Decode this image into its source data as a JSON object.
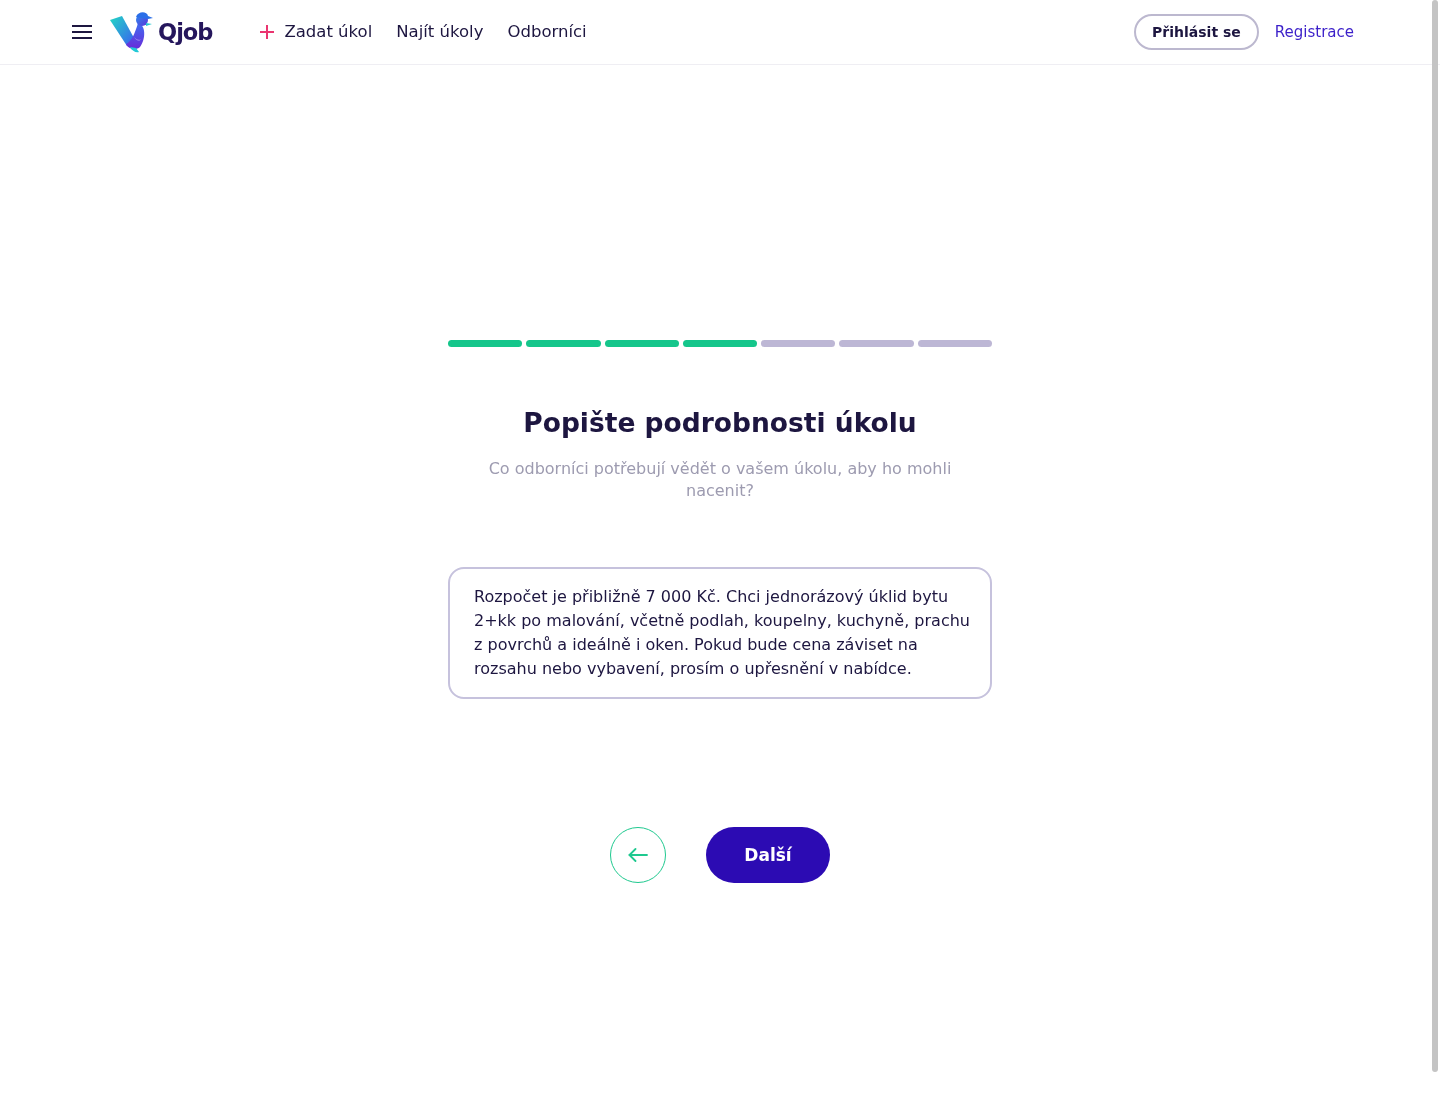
{
  "header": {
    "logo": "Qjob",
    "nav": [
      {
        "label": "Zadat úkol",
        "kind": "add"
      },
      {
        "label": "Najít úkoly",
        "kind": "link"
      },
      {
        "label": "Odborníci",
        "kind": "link"
      }
    ],
    "login_button": "Přihlásit se",
    "register_link": "Registrace"
  },
  "progress": {
    "steps": [
      {
        "completed": true
      },
      {
        "completed": true
      },
      {
        "completed": true
      },
      {
        "completed": true
      },
      {
        "completed": false
      },
      {
        "completed": false
      },
      {
        "completed": false
      }
    ]
  },
  "title": "Popište podrobnosti úkolu",
  "subtitle": "Co odborníci potřebují vědět o vašem úkolu, aby ho mohli nacenit?",
  "description": {
    "value": "Rozpočet je přibližně 7 000 Kč. Chci jednorázový úklid bytu 2+kk po malování, včetně podlah, koupelny, kuchyně, prachu z povrchů a ideálně i oken. Pokud bude cena záviset na rozsahu nebo vybavení, prosím o upřesnění v nabídce."
  },
  "buttons": {
    "next": "Další"
  }
}
